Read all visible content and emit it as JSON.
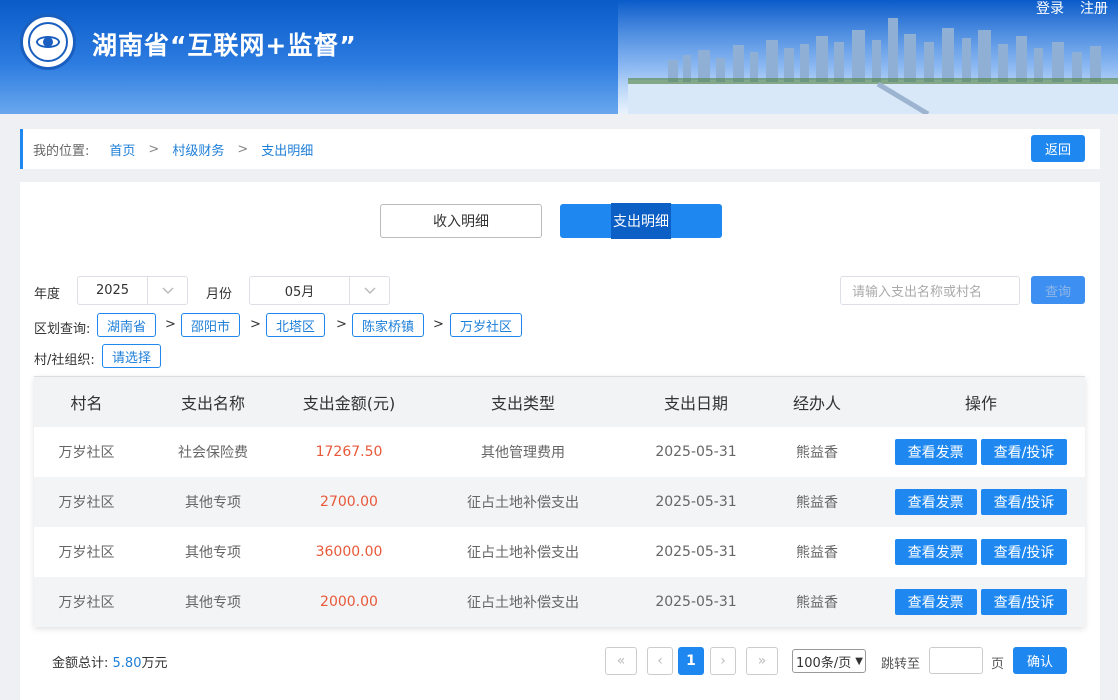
{
  "header": {
    "site_title": "湖南省“互联网+监督”",
    "login": "登录",
    "register": "注册"
  },
  "breadcrumb": {
    "label": "我的位置:",
    "items": [
      "首页",
      "村级财务",
      "支出明细"
    ],
    "separator": ">",
    "back": "返回"
  },
  "tabs": {
    "income": "收入明细",
    "expense": "支出明细"
  },
  "filters": {
    "year_label": "年度",
    "year_value": "2025",
    "month_label": "月份",
    "month_value": "05月",
    "search_placeholder": "请输入支出名称或村名",
    "search_button": "查询",
    "region_label": "区划查询:",
    "regions": [
      "湖南省",
      "邵阳市",
      "北塔区",
      "陈家桥镇",
      "万岁社区"
    ],
    "org_label": "村/社组织:",
    "org_value": "请选择"
  },
  "table": {
    "headers": [
      "村名",
      "支出名称",
      "支出金额(元)",
      "支出类型",
      "支出日期",
      "经办人",
      "操作"
    ],
    "rows": [
      {
        "village": "万岁社区",
        "name": "社会保险费",
        "amount": "17267.50",
        "type": "其他管理费用",
        "date": "2025-05-31",
        "handler": "熊益香"
      },
      {
        "village": "万岁社区",
        "name": "其他专项",
        "amount": "2700.00",
        "type": "征占土地补偿支出",
        "date": "2025-05-31",
        "handler": "熊益香"
      },
      {
        "village": "万岁社区",
        "name": "其他专项",
        "amount": "36000.00",
        "type": "征占土地补偿支出",
        "date": "2025-05-31",
        "handler": "熊益香"
      },
      {
        "village": "万岁社区",
        "name": "其他专项",
        "amount": "2000.00",
        "type": "征占土地补偿支出",
        "date": "2025-05-31",
        "handler": "熊益香"
      }
    ],
    "action_invoice": "查看发票",
    "action_view": "查看/投诉"
  },
  "footer": {
    "total_label": "金额总计:",
    "total_value": "5.80",
    "total_unit": "万元",
    "first": "«",
    "prev": "‹",
    "current_page": "1",
    "next": "›",
    "last": "»",
    "per_page": "100条/页",
    "jump_label": "跳转至",
    "page_unit": "页",
    "confirm": "确认"
  },
  "colors": {
    "accent": "#1e88f0",
    "amount": "#e8593a",
    "header_blue": "#0a5bc9"
  }
}
